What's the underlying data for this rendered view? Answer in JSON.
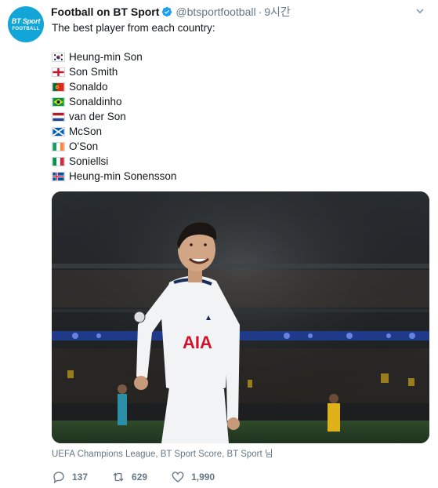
{
  "account": {
    "name": "Football on BT Sport",
    "handle": "@btsportfootball",
    "separator": "·",
    "time": "9시간",
    "avatar_line1": "BT Sport",
    "avatar_line2": "FOOTBALL"
  },
  "tweet": {
    "text": "The best player from each country:",
    "players": [
      {
        "flag": "south-korea",
        "name": "Heung-min Son"
      },
      {
        "flag": "england",
        "name": "Son Smith"
      },
      {
        "flag": "portugal",
        "name": "Sonaldo"
      },
      {
        "flag": "brazil",
        "name": "Sonaldinho"
      },
      {
        "flag": "netherlands",
        "name": "van der Son"
      },
      {
        "flag": "scotland",
        "name": "McSon"
      },
      {
        "flag": "ireland",
        "name": "O'Son"
      },
      {
        "flag": "italy",
        "name": "Soniellsi"
      },
      {
        "flag": "iceland",
        "name": "Heung-min Sonensson"
      }
    ],
    "media_caption": "UEFA Champions League, BT Sport Score, BT Sport 님",
    "jersey_sponsor": "AIA"
  },
  "actions": {
    "replies": "137",
    "retweets": "629",
    "likes": "1,990"
  },
  "colors": {
    "brand": "#12a6d8",
    "verified": "#1da1f2",
    "secondary_text": "#657786"
  }
}
